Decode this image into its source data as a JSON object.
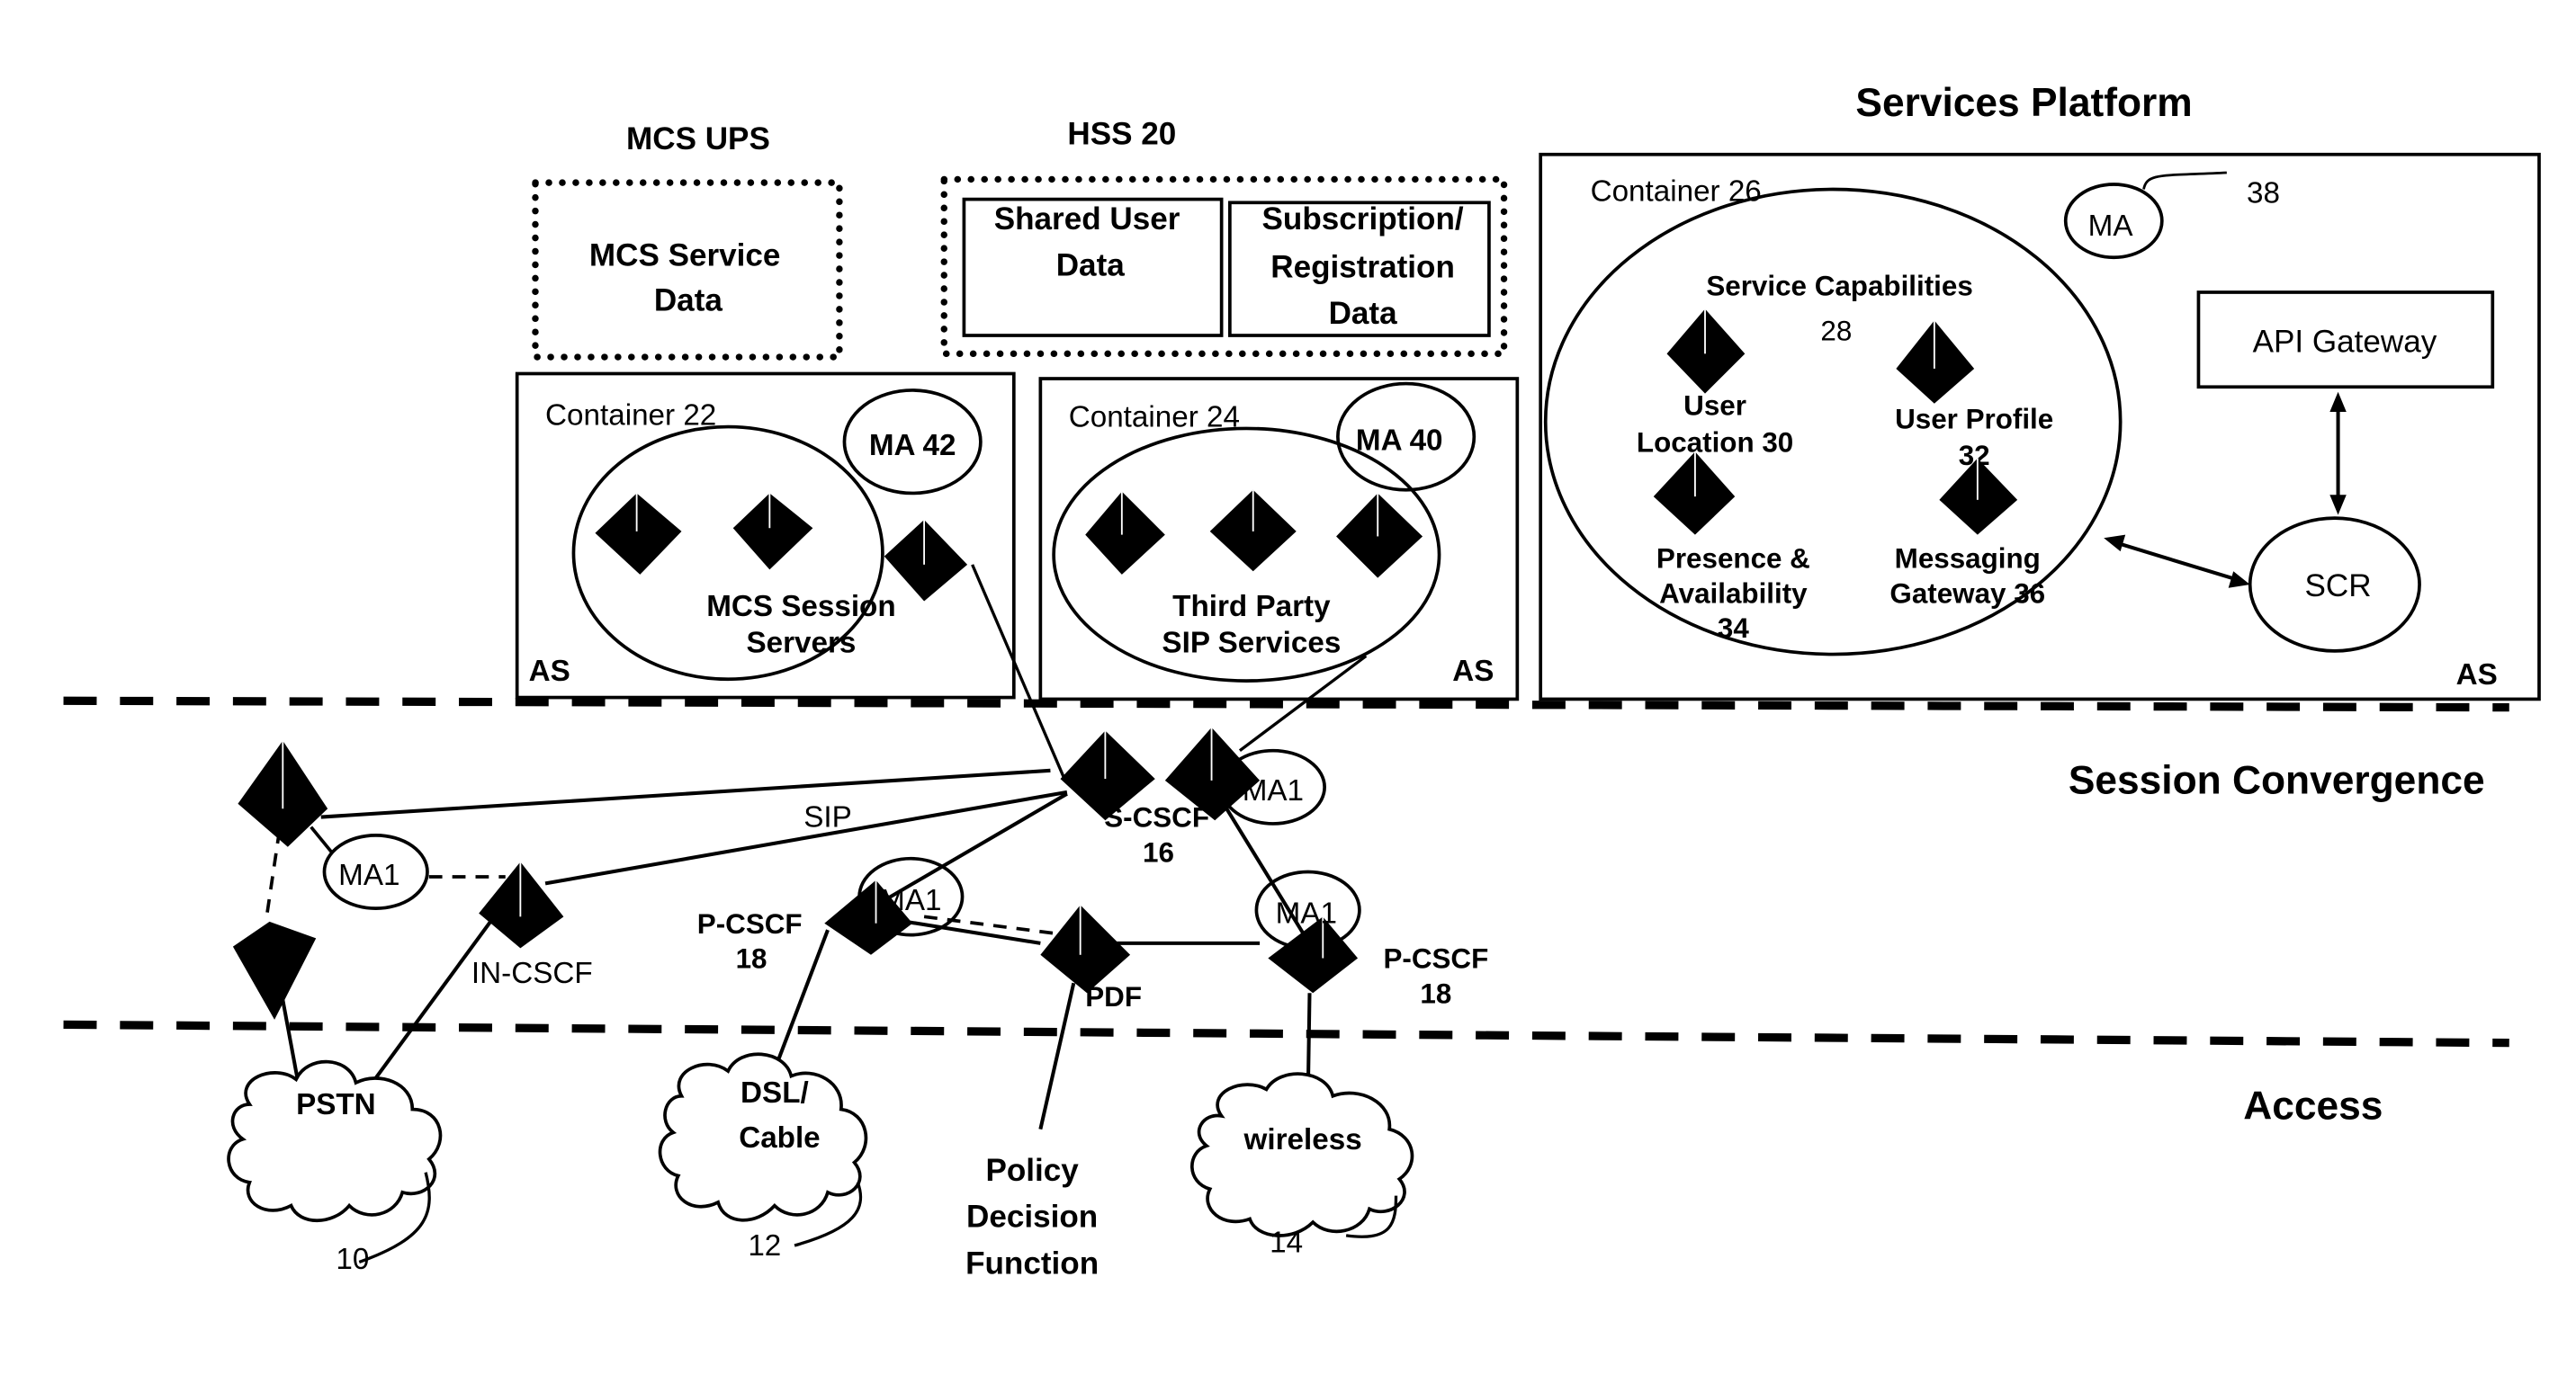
{
  "layers": {
    "services_platform": "Services Platform",
    "session_convergence": "Session Convergence",
    "access": "Access"
  },
  "mcs_ups": {
    "title": "MCS UPS",
    "service_data_line1": "MCS Service",
    "service_data_line2": "Data"
  },
  "hss": {
    "title": "HSS 20",
    "shared_line1": "Shared User",
    "shared_line2": "Data",
    "subscription_line1": "Subscription/",
    "subscription_line2": "Registration",
    "subscription_line3": "Data"
  },
  "container22": {
    "title": "Container 22",
    "ma": "MA 42",
    "servers_line1": "MCS Session",
    "servers_line2": "Servers",
    "as": "AS"
  },
  "container24": {
    "title": "Container 24",
    "ma": "MA 40",
    "services_line1": "Third Party",
    "services_line2": "SIP Services",
    "as": "AS"
  },
  "container26": {
    "title": "Container 26",
    "ma": "MA",
    "ma_ref": "38",
    "capabilities_line1": "Service Capabilities",
    "capabilities_line2": "28",
    "user_location_line1": "User",
    "user_location_line2": "Location 30",
    "user_profile_line1": "User Profile",
    "user_profile_line2": "32",
    "presence_line1": "Presence &",
    "presence_line2": "Availability",
    "presence_line3": "34",
    "messaging_line1": "Messaging",
    "messaging_line2": "Gateway 36",
    "api_gateway": "API Gateway",
    "scr": "SCR",
    "as": "AS"
  },
  "session": {
    "sip": "SIP",
    "ma1": "MA1",
    "s_cscf_line1": "S-CSCF",
    "s_cscf_line2": "16",
    "p_cscf_line1": "P-CSCF",
    "p_cscf_line2": "18",
    "in_cscf": "IN-CSCF",
    "pdf": "PDF"
  },
  "access": {
    "pstn": "PSTN",
    "pstn_ref": "10",
    "dsl_line1": "DSL/",
    "dsl_line2": "Cable",
    "dsl_ref": "12",
    "wireless": "wireless",
    "wireless_ref": "14",
    "policy_line1": "Policy",
    "policy_line2": "Decision",
    "policy_line3": "Function"
  }
}
